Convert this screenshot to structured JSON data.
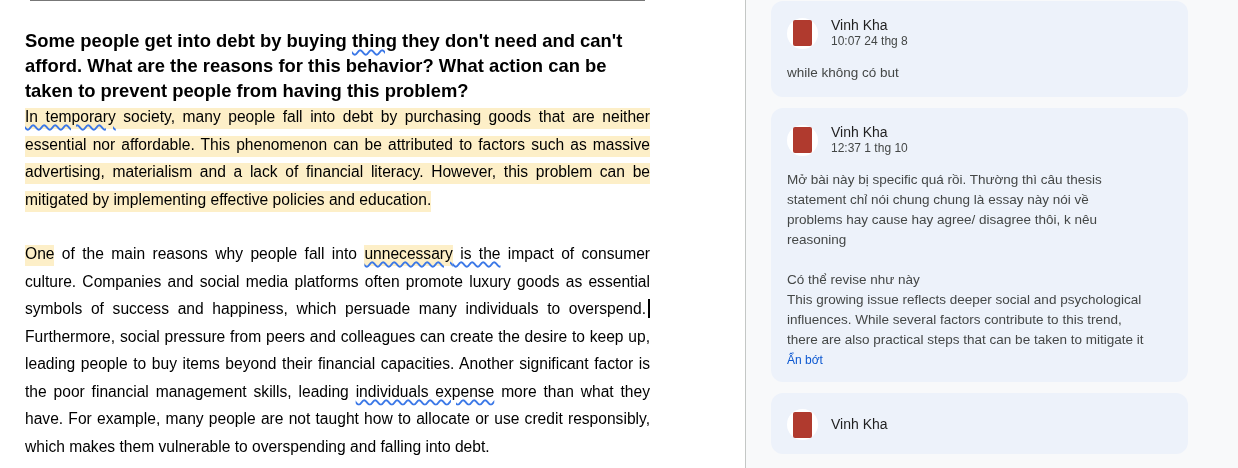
{
  "document": {
    "heading": [
      {
        "text": "Some people get into debt by buying ",
        "spelling_error": false
      },
      {
        "text": "thing",
        "spelling_error": true
      },
      {
        "text": " they don't need and can't afford. What are the reasons for this behavior? What action can be taken to prevent people from having this problem?",
        "spelling_error": false
      }
    ],
    "paragraphs": [
      [
        {
          "kind": "text",
          "text": "In temporary",
          "highlighted": true,
          "spelling_error": true
        },
        {
          "kind": "text",
          "text": " society, many people fall into debt by purchasing goods that are neither essential nor affordable. This phenomenon can be attributed to factors such as massive advertising, materialism and a lack of financial literacy. However, this problem can be mitigated by implementing effective policies and education. ",
          "highlighted": true,
          "spelling_error": false
        }
      ],
      [
        {
          "kind": "text",
          "text": "One",
          "highlighted": true,
          "spelling_error": false
        },
        {
          "kind": "text",
          "text": " of the main reasons why people fall into ",
          "highlighted": false,
          "spelling_error": false
        },
        {
          "kind": "text",
          "text": "unnecessary",
          "highlighted": true,
          "spelling_error": true
        },
        {
          "kind": "text",
          "text": " is the",
          "highlighted": false,
          "spelling_error": true
        },
        {
          "kind": "text",
          "text": " impact of consumer culture. Companies and social media platforms often promote luxury goods as essential symbols of success and happiness, which persuade many individuals to overspend.",
          "highlighted": false,
          "spelling_error": false
        },
        {
          "kind": "cursor"
        },
        {
          "kind": "text",
          "text": " Furthermore, social pressure from peers and colleagues can create the desire to keep up, leading people to buy items beyond their financial capacities. Another significant factor is the poor financial management skills, leading ",
          "highlighted": false,
          "spelling_error": false
        },
        {
          "kind": "text",
          "text": "individuals expense",
          "highlighted": false,
          "spelling_error": true
        },
        {
          "kind": "text",
          "text": " more than what they have. For example, many people are not taught how to allocate or use credit responsibly, which makes them vulnerable to overspending and falling into debt.",
          "highlighted": false,
          "spelling_error": false
        }
      ]
    ]
  },
  "comments": [
    {
      "author": "Vinh Kha",
      "time": "10:07 24 thg 8",
      "body": "while không có but"
    },
    {
      "author": "Vinh Kha",
      "time": "12:37 1 thg 10",
      "body": "Mở bài này bị specific quá rồi. Thường thì câu thesis statement chỉ nói chung chung là essay này nói về problems hay cause hay agree/ disagree thôi, k nêu reasoning\n\nCó thể revise như này\nThis growing issue reflects deeper social and psychological influences. While several factors contribute to this trend, there are also practical steps that can be taken to mitigate it",
      "collapse_link": "Ẩn bớt"
    },
    {
      "author": "Vinh Kha"
    }
  ]
}
